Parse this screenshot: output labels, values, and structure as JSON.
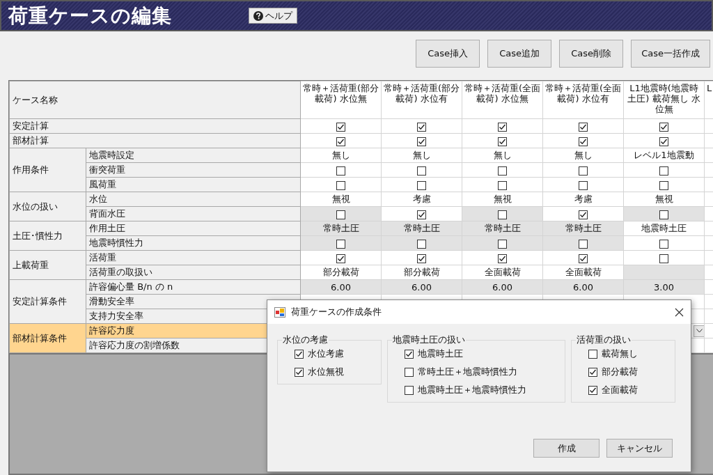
{
  "window": {
    "title": "荷重ケースの編集",
    "help_button": "ヘルプ"
  },
  "toolbar": {
    "buttons": [
      "Case挿入",
      "Case追加",
      "Case削除",
      "Case一括作成"
    ]
  },
  "table": {
    "corner": "ケース名称",
    "columns": [
      "常時＋活荷重(部分載荷) 水位無",
      "常時＋活荷重(部分載荷) 水位有",
      "常時＋活荷重(全面載荷) 水位無",
      "常時＋活荷重(全面載荷) 水位有",
      "L1地震時(地震時土圧) 載荷無し 水位無",
      "L"
    ],
    "rows": [
      {
        "label": "安定計算",
        "selected": false,
        "cells": [
          {
            "kind": "check",
            "checked": true,
            "disabled": false
          },
          {
            "kind": "check",
            "checked": true,
            "disabled": false
          },
          {
            "kind": "check",
            "checked": true,
            "disabled": false
          },
          {
            "kind": "check",
            "checked": true,
            "disabled": false
          },
          {
            "kind": "check",
            "checked": true,
            "disabled": false
          }
        ]
      },
      {
        "label": "部材計算",
        "selected": false,
        "cells": [
          {
            "kind": "check",
            "checked": true,
            "disabled": false
          },
          {
            "kind": "check",
            "checked": true,
            "disabled": false
          },
          {
            "kind": "check",
            "checked": true,
            "disabled": false
          },
          {
            "kind": "check",
            "checked": true,
            "disabled": false
          },
          {
            "kind": "check",
            "checked": true,
            "disabled": false
          }
        ]
      },
      {
        "label": "作用条件",
        "children": [
          {
            "label": "地震時設定",
            "selected": false,
            "cells": [
              {
                "kind": "text",
                "text": "無し",
                "disabled": false
              },
              {
                "kind": "text",
                "text": "無し",
                "disabled": false
              },
              {
                "kind": "text",
                "text": "無し",
                "disabled": false
              },
              {
                "kind": "text",
                "text": "無し",
                "disabled": false
              },
              {
                "kind": "text",
                "text": "レベル1地震動",
                "disabled": false
              }
            ]
          },
          {
            "label": "衝突荷重",
            "selected": false,
            "cells": [
              {
                "kind": "check",
                "checked": false,
                "disabled": false
              },
              {
                "kind": "check",
                "checked": false,
                "disabled": false
              },
              {
                "kind": "check",
                "checked": false,
                "disabled": false
              },
              {
                "kind": "check",
                "checked": false,
                "disabled": false
              },
              {
                "kind": "check",
                "checked": false,
                "disabled": false
              }
            ]
          },
          {
            "label": "風荷重",
            "selected": false,
            "cells": [
              {
                "kind": "check",
                "checked": false,
                "disabled": false
              },
              {
                "kind": "check",
                "checked": false,
                "disabled": false
              },
              {
                "kind": "check",
                "checked": false,
                "disabled": false
              },
              {
                "kind": "check",
                "checked": false,
                "disabled": false
              },
              {
                "kind": "check",
                "checked": false,
                "disabled": false
              }
            ]
          }
        ]
      },
      {
        "label": "水位の扱い",
        "children": [
          {
            "label": "水位",
            "selected": false,
            "cells": [
              {
                "kind": "text",
                "text": "無視",
                "disabled": false
              },
              {
                "kind": "text",
                "text": "考慮",
                "disabled": false
              },
              {
                "kind": "text",
                "text": "無視",
                "disabled": false
              },
              {
                "kind": "text",
                "text": "考慮",
                "disabled": false
              },
              {
                "kind": "text",
                "text": "無視",
                "disabled": false
              }
            ]
          },
          {
            "label": "背面水圧",
            "selected": false,
            "cells": [
              {
                "kind": "check",
                "checked": false,
                "disabled": true
              },
              {
                "kind": "check",
                "checked": true,
                "disabled": false
              },
              {
                "kind": "check",
                "checked": false,
                "disabled": true
              },
              {
                "kind": "check",
                "checked": true,
                "disabled": false
              },
              {
                "kind": "check",
                "checked": false,
                "disabled": true
              }
            ]
          }
        ]
      },
      {
        "label": "土圧･慣性力",
        "children": [
          {
            "label": "作用土圧",
            "selected": false,
            "cells": [
              {
                "kind": "text",
                "text": "常時土圧",
                "disabled": true
              },
              {
                "kind": "text",
                "text": "常時土圧",
                "disabled": true
              },
              {
                "kind": "text",
                "text": "常時土圧",
                "disabled": true
              },
              {
                "kind": "text",
                "text": "常時土圧",
                "disabled": true
              },
              {
                "kind": "text",
                "text": "地震時土圧",
                "disabled": false
              }
            ]
          },
          {
            "label": "地震時慣性力",
            "selected": false,
            "cells": [
              {
                "kind": "check",
                "checked": false,
                "disabled": true
              },
              {
                "kind": "check",
                "checked": false,
                "disabled": true
              },
              {
                "kind": "check",
                "checked": false,
                "disabled": true
              },
              {
                "kind": "check",
                "checked": false,
                "disabled": true
              },
              {
                "kind": "check",
                "checked": false,
                "disabled": false
              }
            ]
          }
        ]
      },
      {
        "label": "上載荷重",
        "children": [
          {
            "label": "活荷重",
            "selected": false,
            "cells": [
              {
                "kind": "check",
                "checked": true,
                "disabled": false
              },
              {
                "kind": "check",
                "checked": true,
                "disabled": false
              },
              {
                "kind": "check",
                "checked": true,
                "disabled": false
              },
              {
                "kind": "check",
                "checked": true,
                "disabled": false
              },
              {
                "kind": "check",
                "checked": false,
                "disabled": false
              }
            ]
          },
          {
            "label": "活荷重の取扱い",
            "selected": false,
            "cells": [
              {
                "kind": "text",
                "text": "部分載荷",
                "disabled": false
              },
              {
                "kind": "text",
                "text": "部分載荷",
                "disabled": false
              },
              {
                "kind": "text",
                "text": "全面載荷",
                "disabled": false
              },
              {
                "kind": "text",
                "text": "全面載荷",
                "disabled": false
              },
              {
                "kind": "blank",
                "disabled": true
              }
            ]
          }
        ]
      },
      {
        "label": "安定計算条件",
        "children": [
          {
            "label": "許容偏心量 B/n の n",
            "selected": false,
            "cells": [
              {
                "kind": "text",
                "text": "6.00",
                "disabled": true
              },
              {
                "kind": "text",
                "text": "6.00",
                "disabled": true
              },
              {
                "kind": "text",
                "text": "6.00",
                "disabled": true
              },
              {
                "kind": "text",
                "text": "6.00",
                "disabled": true
              },
              {
                "kind": "text",
                "text": "3.00",
                "disabled": true
              }
            ]
          },
          {
            "label": "滑動安全率",
            "selected": false
          },
          {
            "label": "支持力安全率",
            "selected": false
          }
        ]
      },
      {
        "label": "部材計算条件",
        "children": [
          {
            "label": "許容応力度",
            "selected": true,
            "cells": [
              null,
              null,
              null,
              null,
              {
                "kind": "dropdown"
              }
            ]
          },
          {
            "label": "許容応力度の割増係数",
            "selected": false
          }
        ]
      }
    ]
  },
  "dialog": {
    "title": "荷重ケースの作成条件",
    "groups": [
      {
        "title": "水位の考慮",
        "options": [
          {
            "label": "水位考慮",
            "checked": true
          },
          {
            "label": "水位無視",
            "checked": true
          }
        ]
      },
      {
        "title": "地震時土圧の扱い",
        "options": [
          {
            "label": "地震時土圧",
            "checked": true
          },
          {
            "label": "常時土圧＋地震時慣性力",
            "checked": false
          },
          {
            "label": "地震時土圧＋地震時慣性力",
            "checked": false
          }
        ]
      },
      {
        "title": "活荷重の扱い",
        "options": [
          {
            "label": "載荷無し",
            "checked": false
          },
          {
            "label": "部分載荷",
            "checked": true
          },
          {
            "label": "全面載荷",
            "checked": true
          }
        ]
      }
    ],
    "buttons": [
      "作成",
      "キャンセル"
    ]
  }
}
